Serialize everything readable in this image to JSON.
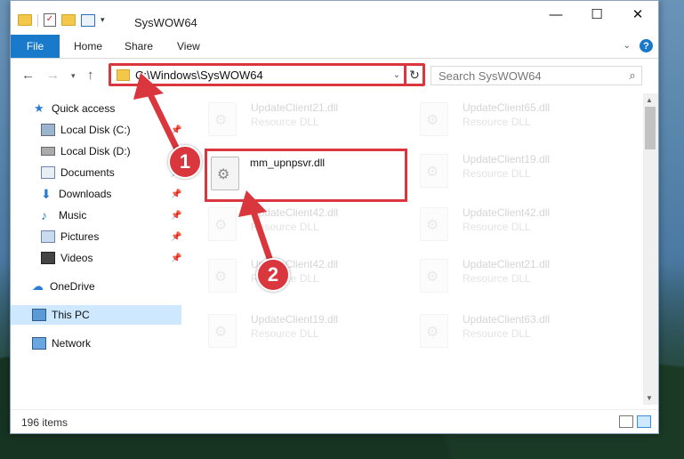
{
  "window": {
    "title": "SysWOW64",
    "controls": {
      "minimize": "—",
      "maximize": "☐",
      "close": "✕"
    }
  },
  "ribbon": {
    "file": "File",
    "tabs": [
      "Home",
      "Share",
      "View"
    ],
    "help": "?"
  },
  "address": {
    "path": "C:\\Windows\\SysWOW64",
    "search_placeholder": "Search SysWOW64"
  },
  "nav": {
    "items": [
      {
        "label": "Quick access",
        "icon": "star-icon"
      },
      {
        "label": "Local Disk (C:)",
        "icon": "drive-icon"
      },
      {
        "label": "Local Disk (D:)",
        "icon": "drive-icon"
      },
      {
        "label": "Documents",
        "icon": "documents-icon"
      },
      {
        "label": "Downloads",
        "icon": "downloads-icon"
      },
      {
        "label": "Music",
        "icon": "music-icon"
      },
      {
        "label": "Pictures",
        "icon": "pictures-icon"
      },
      {
        "label": "Videos",
        "icon": "videos-icon"
      },
      {
        "label": "OneDrive",
        "icon": "cloud-icon"
      },
      {
        "label": "This PC",
        "icon": "computer-icon"
      },
      {
        "label": "Network",
        "icon": "network-icon"
      }
    ]
  },
  "files": {
    "highlighted": {
      "name": "mm_upnpsvr.dll",
      "type": ""
    },
    "background": [
      {
        "name": "UpdateClient21.dll",
        "type": "Resource DLL"
      },
      {
        "name": "UpdateClient65.dll",
        "type": "Resource DLL"
      },
      {
        "name": "UpdateClient19.dll",
        "type": "Resource DLL"
      },
      {
        "name": "UpdateClient42.dll",
        "type": "Resource DLL"
      },
      {
        "name": "UpdateClient42.dll",
        "type": "Resource DLL"
      },
      {
        "name": "UpdateClient42.dll",
        "type": "Resource DLL"
      },
      {
        "name": "UpdateClient21.dll",
        "type": "Resource DLL"
      },
      {
        "name": "UpdateClient19.dll",
        "type": "Resource DLL"
      },
      {
        "name": "UpdateClient63.dll",
        "type": "Resource DLL"
      }
    ]
  },
  "status": {
    "item_count": "196 items"
  },
  "annotations": {
    "marker1": "1",
    "marker2": "2",
    "accent": "#d9363e"
  }
}
